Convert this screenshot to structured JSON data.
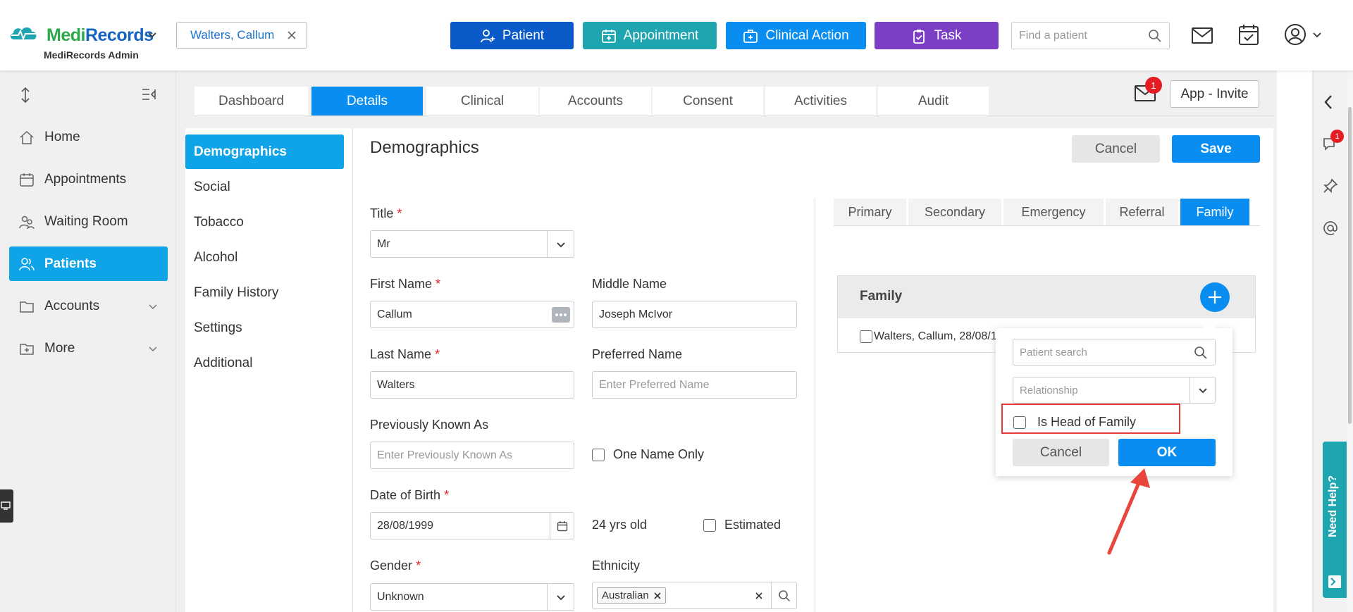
{
  "header": {
    "brand": "MediRecords",
    "brand_sub": "MediRecords Admin",
    "patient_chip": "Walters, Callum",
    "buttons": {
      "patient": "Patient",
      "appointment": "Appointment",
      "clinical": "Clinical Action",
      "task": "Task"
    },
    "search_placeholder": "Find a patient",
    "colors": {
      "patient": "#0a5bc9",
      "appointment": "#1ea5b0",
      "clinical": "#0a8df0",
      "task": "#7a3fc4"
    }
  },
  "sidebar": {
    "items": [
      {
        "label": "Home",
        "icon": "home-icon"
      },
      {
        "label": "Appointments",
        "icon": "calendar-icon"
      },
      {
        "label": "Waiting Room",
        "icon": "people-icon"
      },
      {
        "label": "Patients",
        "icon": "users-icon"
      },
      {
        "label": "Accounts",
        "icon": "folder-icon"
      },
      {
        "label": "More",
        "icon": "more-folder-icon"
      }
    ],
    "active": "Patients"
  },
  "tabs": [
    "Dashboard",
    "Details",
    "Clinical",
    "Accounts",
    "Consent",
    "Activities",
    "Audit"
  ],
  "active_tab": "Details",
  "mail_badge": "1",
  "app_invite": "App - Invite",
  "leftnav": [
    "Demographics",
    "Social",
    "Tobacco",
    "Alcohol",
    "Family History",
    "Settings",
    "Additional"
  ],
  "section_title": "Demographics",
  "actions": {
    "cancel": "Cancel",
    "save": "Save"
  },
  "form": {
    "title_label": "Title",
    "title_value": "Mr",
    "first_name_label": "First Name",
    "first_name_value": "Callum",
    "middle_name_label": "Middle Name",
    "middle_name_value": "Joseph McIvor",
    "last_name_label": "Last Name",
    "last_name_value": "Walters",
    "preferred_name_label": "Preferred Name",
    "preferred_name_placeholder": "Enter Preferred Name",
    "prev_known_label": "Previously Known As",
    "prev_known_placeholder": "Enter Previously Known As",
    "one_name_only": "One Name Only",
    "dob_label": "Date of Birth",
    "dob_value": "28/08/1999",
    "age": "24 yrs old",
    "estimated": "Estimated",
    "gender_label": "Gender",
    "gender_value": "Unknown",
    "ethnicity_label": "Ethnicity",
    "ethnicity_tag": "Australian",
    "required_mark": "*"
  },
  "subtabs": [
    "Primary",
    "Secondary",
    "Emergency",
    "Referral",
    "Family"
  ],
  "active_subtab": "Family",
  "family": {
    "heading": "Family",
    "row": "Walters, Callum, 28/08/1"
  },
  "popup": {
    "patient_search_placeholder": "Patient search",
    "relationship_placeholder": "Relationship",
    "head_of_family": "Is Head of Family",
    "cancel": "Cancel",
    "ok": "OK"
  },
  "right_rail": {
    "chat_badge": "1",
    "help": "Need Help?"
  }
}
